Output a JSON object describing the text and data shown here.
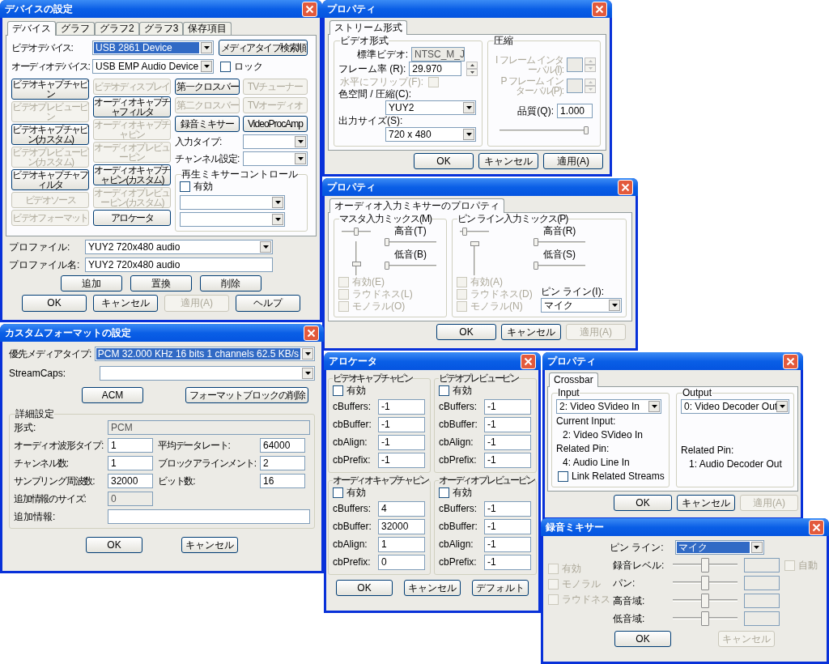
{
  "windows": [
    {
      "kind": "device_settings",
      "title": "デバイスの設定",
      "tabs": [
        {
          "label": "デバイス",
          "selected": true
        },
        {
          "label": "グラフ",
          "selected": false
        },
        {
          "label": "グラフ2",
          "selected": false
        },
        {
          "label": "グラフ3",
          "selected": false
        },
        {
          "label": "保存項目",
          "selected": false
        }
      ],
      "device_rows": [
        {
          "label": "ビデオデバイス:",
          "value": "USB 2861 Device",
          "highlighted": true
        },
        {
          "label": "オーディオデバイス:",
          "value": "USB EMP Audio Device",
          "highlighted": false
        }
      ],
      "media_type_button": {
        "label": "メディアタイプ検索順",
        "disabled": false
      },
      "lock": {
        "label": "ロック",
        "checked": false
      },
      "pin_columns": [
        [
          {
            "label": "ビデオキャプチャピン",
            "disabled": false
          },
          {
            "label": "ビデオプレビューピン",
            "disabled": true
          },
          {
            "label": "ビデオキャプチャピン(カスタム)",
            "disabled": false
          },
          {
            "label": "ビデオプレビューピン(カスタム)",
            "disabled": true
          },
          {
            "label": "ビデオキャプチャフィルタ",
            "disabled": false
          },
          {
            "label": "ビデオソース",
            "disabled": true
          },
          {
            "label": "ビデオフォーマット",
            "disabled": true
          }
        ],
        [
          {
            "label": "ビデオディスプレイ",
            "disabled": true
          },
          {
            "label": "オーディオキャプチャフィルタ",
            "disabled": false
          },
          {
            "label": "オーディオキャプチャピン",
            "disabled": true
          },
          {
            "label": "オーディオプレビューピン",
            "disabled": true
          },
          {
            "label": "オーディオキャプチャピン(カスタム)",
            "disabled": false
          },
          {
            "label": "オーディオプレビューピン(カスタム)",
            "disabled": true
          },
          {
            "label": "アロケータ",
            "disabled": false
          }
        ]
      ],
      "filter_buttons": [
        {
          "label": "第一クロスバー",
          "disabled": false
        },
        {
          "label": "TVチューナー",
          "disabled": true
        },
        {
          "label": "第二クロスバー",
          "disabled": true
        },
        {
          "label": "TVオーディオ",
          "disabled": true
        },
        {
          "label": "録音ミキサー",
          "disabled": false
        },
        {
          "label": "VideoProcAmp",
          "disabled": false
        }
      ],
      "input_type": {
        "label": "入力タイプ:"
      },
      "channel_setting": {
        "label": "チャンネル設定:"
      },
      "playback_mixer": {
        "title": "再生ミキサーコントロール",
        "enable": {
          "label": "有効",
          "checked": false
        }
      },
      "profile": {
        "label": "プロファイル:",
        "value": "YUY2 720x480 audio"
      },
      "profile_name": {
        "label": "プロファイル名:",
        "value": "YUY2 720x480 audio"
      },
      "profile_buttons": [
        {
          "label": "追加",
          "disabled": false
        },
        {
          "label": "置換",
          "disabled": false
        },
        {
          "label": "削除",
          "disabled": false
        }
      ],
      "buttons": [
        {
          "label": "OK",
          "disabled": false
        },
        {
          "label": "キャンセル",
          "disabled": false
        },
        {
          "label": "適用(A)",
          "disabled": true
        },
        {
          "label": "ヘルプ",
          "disabled": false
        }
      ]
    },
    {
      "kind": "stream_format",
      "title": "プロパティ",
      "tabs": [
        {
          "label": "ストリーム形式",
          "selected": true
        }
      ],
      "video_format": {
        "title": "ビデオ形式",
        "standard": {
          "label": "標準ビデオ:",
          "value": "NTSC_M_J",
          "readonly": true
        },
        "frame_rate": {
          "label": "フレーム率 (R):",
          "value": "29.970"
        },
        "flip": {
          "label": "水平にフリップ(F):",
          "checked": false,
          "disabled": true
        },
        "color_space": {
          "label": "色空間 / 圧縮(C):",
          "value": "YUY2"
        },
        "output_size": {
          "label": "出力サイズ(S):",
          "value": "720 x 480"
        }
      },
      "compression": {
        "title": "圧縮",
        "i_frame": {
          "label": "I フレーム インターバル(I):",
          "disabled": true
        },
        "p_frame": {
          "label": "P フレーム インターバル(P):",
          "disabled": true
        },
        "quality": {
          "label": "品質(Q):",
          "value": "1.000",
          "level": 1
        }
      },
      "buttons": [
        {
          "label": "OK",
          "disabled": false
        },
        {
          "label": "キャンセル",
          "disabled": false
        },
        {
          "label": "適用(A)",
          "disabled": false
        }
      ]
    },
    {
      "kind": "audio_mixer",
      "title": "プロパティ",
      "tabs": [
        {
          "label": "オーディオ入力ミキサーのプロパティ",
          "selected": true
        }
      ],
      "groups": [
        {
          "title": "マスタ入力ミックス(M)",
          "balance": {
            "level": 0.5
          },
          "volume": {
            "level": 0.3
          },
          "treble": {
            "label": "高音(T)",
            "level": 0
          },
          "bass": {
            "label": "低音(B)",
            "level": 0
          },
          "checkboxes": [
            {
              "label": "有効(E)",
              "checked": false,
              "disabled": true
            },
            {
              "label": "ラウドネス(L)",
              "checked": false,
              "disabled": true
            },
            {
              "label": "モノラル(O)",
              "checked": false,
              "disabled": true
            }
          ]
        },
        {
          "title": "ピン ライン入力ミックス(P)",
          "balance": {
            "level": 0.1
          },
          "volume": {
            "level": 1
          },
          "treble": {
            "label": "高音(R)",
            "level": 0
          },
          "bass": {
            "label": "低音(S)",
            "level": 0
          },
          "checkboxes": [
            {
              "label": "有効(A)",
              "checked": false,
              "disabled": true
            },
            {
              "label": "ラウドネス(D)",
              "checked": false,
              "disabled": true
            },
            {
              "label": "モノラル(N)",
              "checked": false,
              "disabled": true
            }
          ],
          "pin_line": {
            "label": "ピン ライン(I):",
            "value": "マイク"
          }
        }
      ],
      "buttons": [
        {
          "label": "OK",
          "disabled": false
        },
        {
          "label": "キャンセル",
          "disabled": false
        },
        {
          "label": "適用(A)",
          "disabled": true
        }
      ]
    },
    {
      "kind": "custom_format",
      "title": "カスタムフォーマットの設定",
      "media_type": {
        "label": "優先メディアタイプ:",
        "value": "PCM 32.000 KHz 16 bits 1 channels 62.5 KB/s",
        "highlighted": true
      },
      "stream_caps": {
        "label": "StreamCaps:"
      },
      "top_buttons": [
        {
          "label": "ACM",
          "disabled": false
        },
        {
          "label": "フォーマットブロックの削除",
          "disabled": false
        }
      ],
      "details": {
        "title": "詳細設定",
        "format": {
          "label": "形式:",
          "value": "PCM",
          "readonly": true
        },
        "fields": [
          {
            "label": "オーディオ波形タイプ:",
            "value": "1"
          },
          {
            "label": "平均データレート:",
            "value": "64000"
          },
          {
            "label": "チャンネル数:",
            "value": "1"
          },
          {
            "label": "ブロックアラインメント:",
            "value": "2"
          },
          {
            "label": "サンプリング周波数:",
            "value": "32000"
          },
          {
            "label": "ビット数:",
            "value": "16"
          }
        ],
        "extra_size": {
          "label": "追加情報のサイズ:",
          "value": "0",
          "readonly": true
        },
        "extra": {
          "label": "追加情報:"
        }
      },
      "buttons": [
        {
          "label": "OK",
          "disabled": false
        },
        {
          "label": "キャンセル",
          "disabled": false
        }
      ]
    },
    {
      "kind": "allocator",
      "title": "アロケータ",
      "groups": [
        {
          "title": "ビデオキャプチャピン",
          "enable": {
            "label": "有効",
            "checked": false
          },
          "fields": [
            {
              "label": "cBuffers:",
              "value": "-1"
            },
            {
              "label": "cbBuffer:",
              "value": "-1"
            },
            {
              "label": "cbAlign:",
              "value": "-1"
            },
            {
              "label": "cbPrefix:",
              "value": "-1"
            }
          ]
        },
        {
          "title": "ビデオプレビューピン",
          "enable": {
            "label": "有効",
            "checked": false
          },
          "fields": [
            {
              "label": "cBuffers:",
              "value": "-1"
            },
            {
              "label": "cbBuffer:",
              "value": "-1"
            },
            {
              "label": "cbAlign:",
              "value": "-1"
            },
            {
              "label": "cbPrefix:",
              "value": "-1"
            }
          ]
        },
        {
          "title": "オーディオキャプチャピン",
          "enable": {
            "label": "有効",
            "checked": false
          },
          "fields": [
            {
              "label": "cBuffers:",
              "value": "4"
            },
            {
              "label": "cbBuffer:",
              "value": "32000"
            },
            {
              "label": "cbAlign:",
              "value": "1"
            },
            {
              "label": "cbPrefix:",
              "value": "0"
            }
          ]
        },
        {
          "title": "オーディオプレビューピン",
          "enable": {
            "label": "有効",
            "checked": false
          },
          "fields": [
            {
              "label": "cBuffers:",
              "value": "-1"
            },
            {
              "label": "cbBuffer:",
              "value": "-1"
            },
            {
              "label": "cbAlign:",
              "value": "-1"
            },
            {
              "label": "cbPrefix:",
              "value": "-1"
            }
          ]
        }
      ],
      "buttons": [
        {
          "label": "OK",
          "disabled": false
        },
        {
          "label": "キャンセル",
          "disabled": false
        },
        {
          "label": "デフォルト",
          "disabled": false
        }
      ]
    },
    {
      "kind": "crossbar",
      "title": "プロパティ",
      "tabs": [
        {
          "label": "Crossbar",
          "selected": true
        }
      ],
      "input": {
        "title": "Input",
        "value": "2: Video SVideo In",
        "current_input_label": "Current Input:",
        "current_input": "2: Video SVideo In",
        "related_pin_label": "Related Pin:",
        "related_pin": "4: Audio Line In",
        "link": {
          "label": "Link Related Streams",
          "checked": false
        }
      },
      "output": {
        "title": "Output",
        "value": "0: Video Decoder Out",
        "related_pin_label": "Related Pin:",
        "related_pin": "1: Audio Decoder Out"
      },
      "buttons": [
        {
          "label": "OK",
          "disabled": false
        },
        {
          "label": "キャンセル",
          "disabled": false
        },
        {
          "label": "適用(A)",
          "disabled": true
        }
      ]
    },
    {
      "kind": "record_mixer",
      "title": "録音ミキサー",
      "pin_line": {
        "label": "ピン ライン:",
        "value": "マイク",
        "highlighted": true
      },
      "options": [
        {
          "label": "有効",
          "checked": false,
          "disabled": true
        },
        {
          "label": "モノラル",
          "checked": false,
          "disabled": true
        },
        {
          "label": "ラウドネス",
          "checked": false,
          "disabled": true
        }
      ],
      "sliders": [
        {
          "label": "録音レベル:",
          "level": 0.5
        },
        {
          "label": "パン:",
          "level": 0.5
        },
        {
          "label": "高音域:",
          "level": 0.5
        },
        {
          "label": "低音域:",
          "level": 0.5
        }
      ],
      "auto": {
        "label": "自動",
        "checked": false,
        "disabled": true
      },
      "buttons": [
        {
          "label": "OK",
          "disabled": false
        },
        {
          "label": "キャンセル",
          "disabled": true
        }
      ]
    }
  ]
}
